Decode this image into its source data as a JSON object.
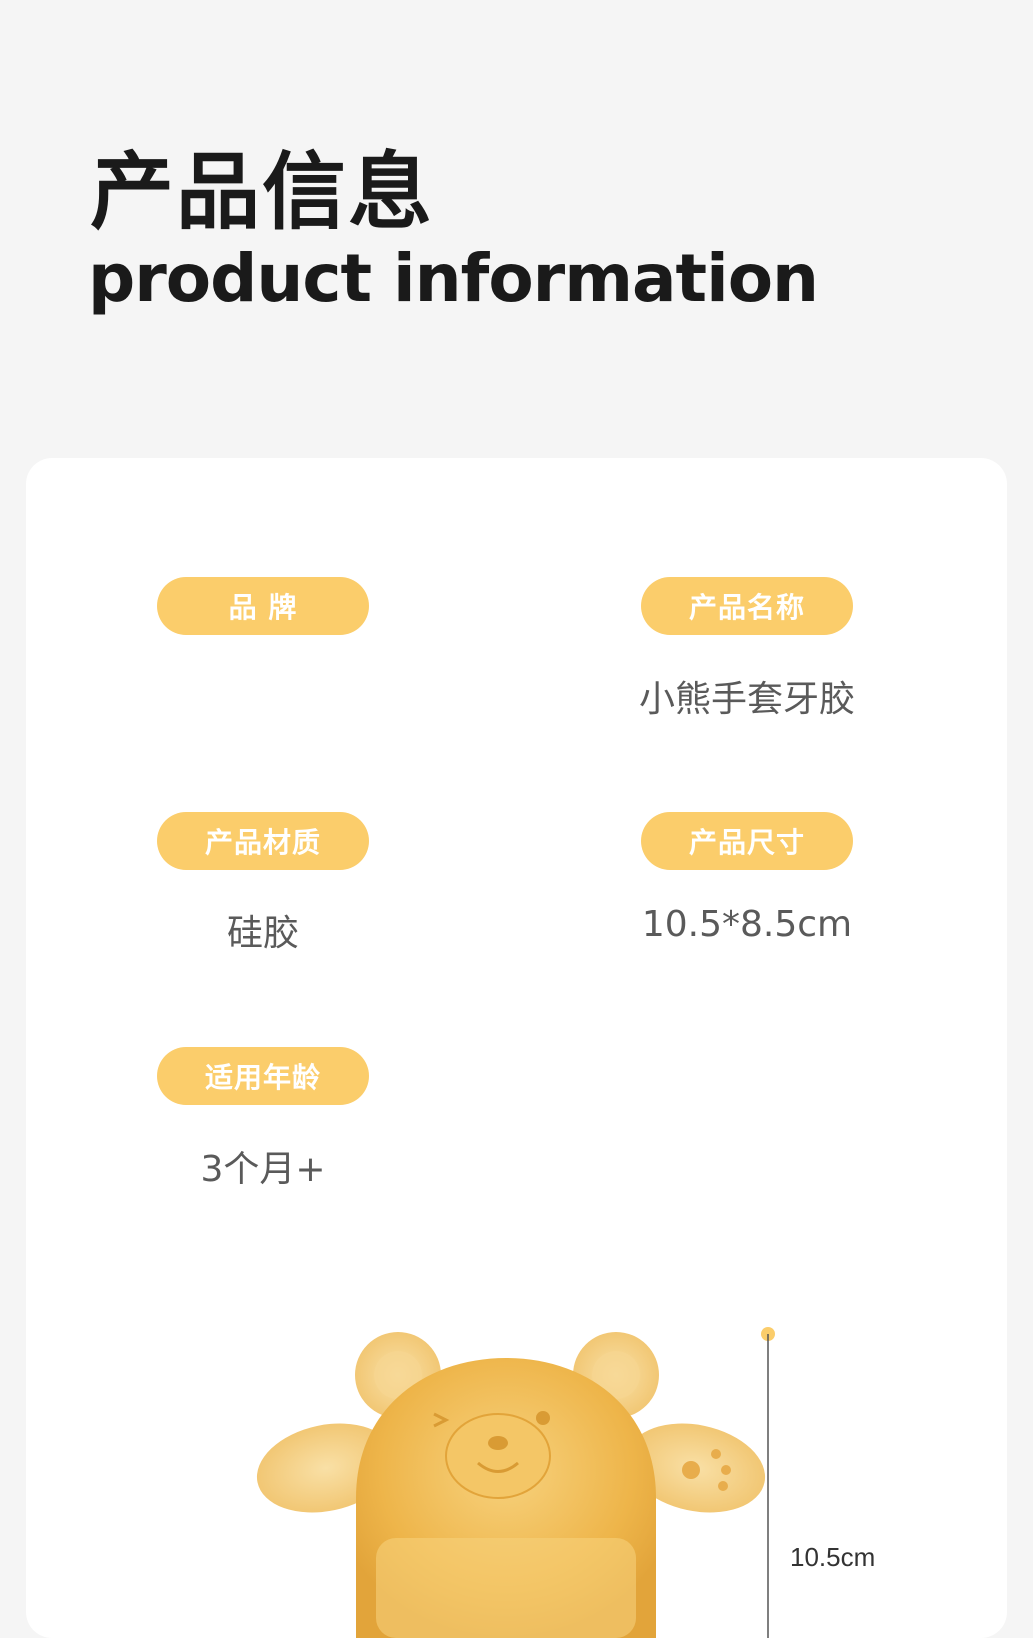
{
  "header": {
    "title_cn": "产品信息",
    "title_en": "product information"
  },
  "info": {
    "brand_label": "品 牌",
    "brand_value": "",
    "name_label": "产品名称",
    "name_value": "小熊手套牙胶",
    "material_label": "产品材质",
    "material_value": "硅胶",
    "size_label": "产品尺寸",
    "size_value": "10.5*8.5cm",
    "age_label": "适用年龄",
    "age_value": "3个月+"
  },
  "illustration": {
    "height_dimension": "10.5cm",
    "colors": {
      "bear": "#f0b94e",
      "accent": "#fbcd6b"
    }
  }
}
